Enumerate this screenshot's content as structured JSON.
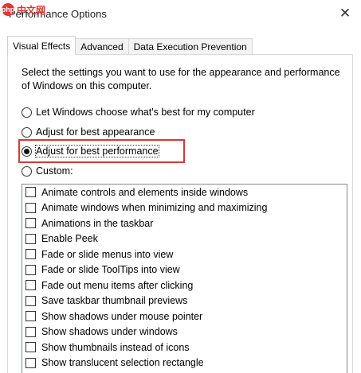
{
  "watermark": {
    "logo": "php",
    "text": "中文网"
  },
  "window": {
    "title": "Performance Options",
    "close_glyph": "✕"
  },
  "tabs": [
    {
      "label": "Visual Effects",
      "active": true
    },
    {
      "label": "Advanced",
      "active": false
    },
    {
      "label": "Data Execution Prevention",
      "active": false
    }
  ],
  "visual_effects": {
    "description": "Select the settings you want to use for the appearance and performance of Windows on this computer.",
    "radios": [
      {
        "label": "Let Windows choose what's best for my computer",
        "checked": false
      },
      {
        "label": "Adjust for best appearance",
        "checked": false
      },
      {
        "label": "Adjust for best performance",
        "checked": true
      },
      {
        "label": "Custom:",
        "checked": false
      }
    ],
    "highlight_color": "#d33a3a",
    "effects": [
      {
        "label": "Animate controls and elements inside windows",
        "checked": false
      },
      {
        "label": "Animate windows when minimizing and maximizing",
        "checked": false
      },
      {
        "label": "Animations in the taskbar",
        "checked": false
      },
      {
        "label": "Enable Peek",
        "checked": false
      },
      {
        "label": "Fade or slide menus into view",
        "checked": false
      },
      {
        "label": "Fade or slide ToolTips into view",
        "checked": false
      },
      {
        "label": "Fade out menu items after clicking",
        "checked": false
      },
      {
        "label": "Save taskbar thumbnail previews",
        "checked": false
      },
      {
        "label": "Show shadows under mouse pointer",
        "checked": false
      },
      {
        "label": "Show shadows under windows",
        "checked": false
      },
      {
        "label": "Show thumbnails instead of icons",
        "checked": false
      },
      {
        "label": "Show translucent selection rectangle",
        "checked": false
      }
    ]
  }
}
